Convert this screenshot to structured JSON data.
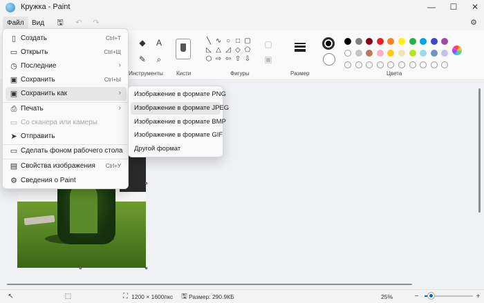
{
  "window": {
    "title": "Кружка - Paint",
    "controls": {
      "minimize": "—",
      "maximize": "☐",
      "close": "✕"
    }
  },
  "menubar": {
    "tabs": [
      {
        "label": "Файл",
        "active": true
      },
      {
        "label": "Вид",
        "active": false
      }
    ],
    "quick_access": {
      "save_icon": "save-icon",
      "undo_icon": "undo-icon",
      "redo_icon": "redo-icon"
    }
  },
  "ribbon": {
    "groups": {
      "tools": "Инструменты",
      "brushes": "Кисти",
      "shapes": "Фигуры",
      "size": "Размер",
      "colors": "Цвета"
    },
    "tool_icons": {
      "fill": "▾",
      "text": "A",
      "picker": "✎",
      "zoom": "⌕"
    },
    "primary_color": "#000000",
    "secondary_color": "#ffffff",
    "palette": [
      [
        "#000000",
        "#7f7f7f",
        "#880015",
        "#ed1c24",
        "#ff7f27",
        "#fff200",
        "#22b14c",
        "#00a2e8",
        "#3f48cc",
        "#a349a4"
      ],
      [
        "#ffffff",
        "#c3c3c3",
        "#b97a57",
        "#ffaec9",
        "#ffc90e",
        "#efe4b0",
        "#b5e61d",
        "#99d9ea",
        "#7092be",
        "#c8bfe7"
      ]
    ]
  },
  "file_menu": {
    "items": [
      {
        "label": "Создать",
        "icon": "📄",
        "shortcut": "Ctrl+T"
      },
      {
        "label": "Открыть",
        "icon": "📁",
        "shortcut": "Ctrl+Щ"
      },
      {
        "label": "Последние",
        "icon": "🕓",
        "arrow": "›"
      },
      {
        "label": "Сохранить",
        "icon": "💾",
        "shortcut": "Ctrl+Ы"
      },
      {
        "label": "Сохранить как",
        "icon": "🖫",
        "arrow": "›"
      },
      {
        "label": "Печать",
        "icon": "🖨",
        "arrow": "›"
      },
      {
        "label": "Со сканера или камеры",
        "icon": "▭"
      },
      {
        "label": "Отправить",
        "icon": "➤"
      },
      {
        "label": "Сделать фоном рабочего стола",
        "icon": "▭",
        "arrow": "›"
      },
      {
        "label": "Свойства изображения",
        "icon": "▤",
        "shortcut": "Ctrl+У"
      },
      {
        "label": "Сведения о Paint",
        "icon": "⚙"
      }
    ]
  },
  "save_as_menu": {
    "items": [
      {
        "label": "Изображение в формате PNG"
      },
      {
        "label": "Изображение в формате JPEG"
      },
      {
        "label": "Изображение в формате BMP"
      },
      {
        "label": "Изображение в формате GIF"
      },
      {
        "label": "Другой формат"
      }
    ]
  },
  "statusbar": {
    "dimensions": "1200 × 1600пкс",
    "size": "Размер: 290.9КБ",
    "zoom": "25%",
    "zoom_fraction": 0.14
  }
}
